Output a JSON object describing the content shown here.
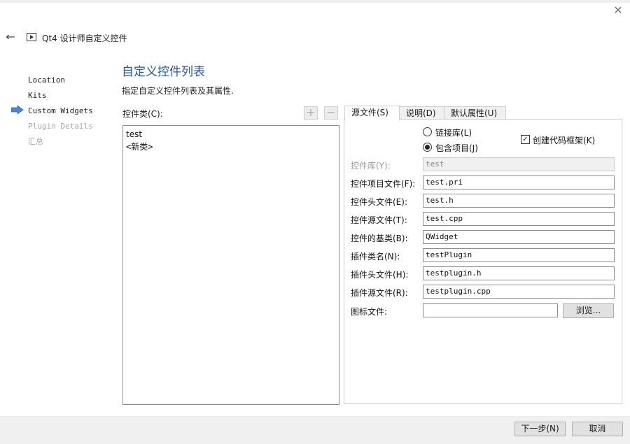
{
  "window": {
    "title": "Qt4 设计师自定义控件"
  },
  "steps": [
    {
      "label": "Location",
      "state": "done"
    },
    {
      "label": "Kits",
      "state": "done"
    },
    {
      "label": "Custom Widgets",
      "state": "current"
    },
    {
      "label": "Plugin Details",
      "state": "disabled"
    },
    {
      "label": "汇总",
      "state": "disabled"
    }
  ],
  "page": {
    "title": "自定义控件列表",
    "subtitle": "指定自定义控件列表及其属性."
  },
  "classes": {
    "label": "控件类(C):",
    "items": [
      "test",
      "<新类>"
    ]
  },
  "tabs": [
    {
      "label": "源文件(S)",
      "active": true
    },
    {
      "label": "说明(D)",
      "active": false
    },
    {
      "label": "默认属性(U)",
      "active": false
    }
  ],
  "options": {
    "link_library": "链接库(L)",
    "include_project": "包含项目(J)",
    "selected": "include_project",
    "create_skeleton": "创建代码框架(K)",
    "create_skeleton_checked": true
  },
  "fields": [
    {
      "label": "控件库(Y):",
      "value": "test",
      "disabled": true
    },
    {
      "label": "控件项目文件(F):",
      "value": "test.pri",
      "disabled": false
    },
    {
      "label": "控件头文件(E):",
      "value": "test.h",
      "disabled": false
    },
    {
      "label": "控件源文件(T):",
      "value": "test.cpp",
      "disabled": false
    },
    {
      "label": "控件的基类(B):",
      "value": "QWidget",
      "disabled": false
    },
    {
      "label": "插件类名(N):",
      "value": "testPlugin",
      "disabled": false
    },
    {
      "label": "插件头文件(H):",
      "value": "testplugin.h",
      "disabled": false
    },
    {
      "label": "插件源文件(R):",
      "value": "testplugin.cpp",
      "disabled": false
    },
    {
      "label": "图标文件:",
      "value": "",
      "disabled": false
    }
  ],
  "browse_label": "浏览...",
  "footer": {
    "next": "下一步(N)",
    "cancel": "取消"
  },
  "colors": {
    "title_blue": "#2b5797",
    "step_arrow": "#4a86d8",
    "disabled_text": "#a8a8a8"
  }
}
